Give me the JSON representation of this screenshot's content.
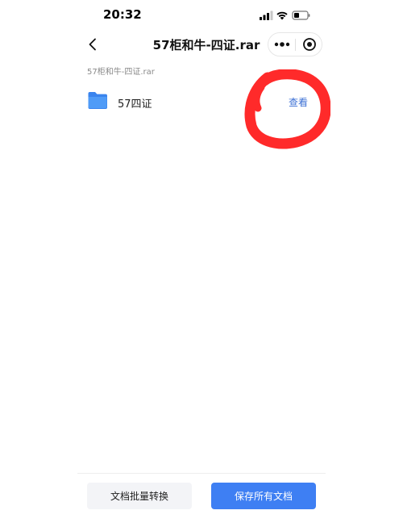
{
  "status_bar": {
    "time": "20:32"
  },
  "nav": {
    "title": "57柜和牛-四证.rar",
    "back_icon": "chevron-left-icon",
    "more_icon": "more-dots-icon",
    "close_icon": "target-close-icon"
  },
  "breadcrumb": "57柜和牛-四证.rar",
  "files": [
    {
      "icon": "folder-icon",
      "name": "57四证",
      "action_label": "查看"
    }
  ],
  "toolbar": {
    "convert_label": "文档批量转换",
    "save_all_label": "保存所有文档"
  },
  "colors": {
    "accent": "#3e7ff3",
    "link": "#3b6fd4",
    "folder": "#4a90f0",
    "annotation": "#ff2a2a",
    "secondary_button_bg": "#f3f4f7",
    "muted_text": "#8a8a8a"
  }
}
